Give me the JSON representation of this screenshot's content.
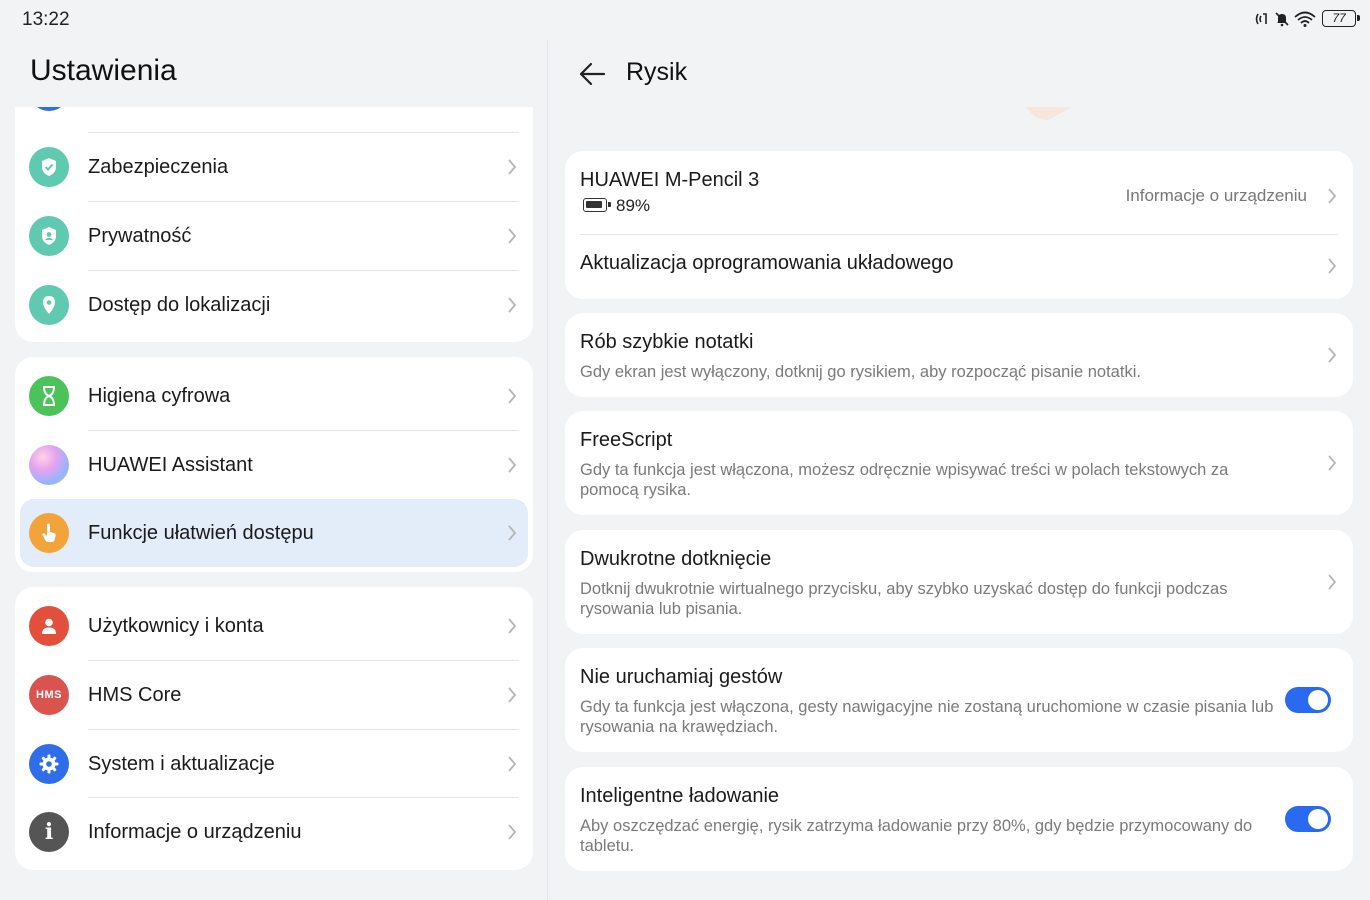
{
  "status": {
    "time": "13:22",
    "battery": "77"
  },
  "left": {
    "title": "Ustawienia",
    "groups": [
      {
        "items": [
          {
            "label": "Zabezpieczenia",
            "icon": "shield-check-icon",
            "color": "#5fcab0"
          },
          {
            "label": "Prywatność",
            "icon": "privacy-shield-icon",
            "color": "#5fcab0"
          },
          {
            "label": "Dostęp do lokalizacji",
            "icon": "location-pin-icon",
            "color": "#5fcab0"
          }
        ]
      },
      {
        "items": [
          {
            "label": "Higiena cyfrowa",
            "icon": "hourglass-icon",
            "color": "#4cc35a"
          },
          {
            "label": "HUAWEI Assistant",
            "icon": "assistant-orb-icon",
            "color": "#c9a1e0"
          },
          {
            "label": "Funkcje ułatwień dostępu",
            "icon": "hand-pointer-icon",
            "color": "#f2a33a",
            "selected": true
          }
        ]
      },
      {
        "items": [
          {
            "label": "Użytkownicy i konta",
            "icon": "user-icon",
            "color": "#e2503c"
          },
          {
            "label": "HMS Core",
            "icon": "hms-icon",
            "icon_text": "HMS",
            "color": "#d9534f"
          },
          {
            "label": "System i aktualizacje",
            "icon": "gear-icon",
            "color": "#2f6ee8"
          },
          {
            "label": "Informacje o urządzeniu",
            "icon": "info-icon",
            "color": "#555555"
          }
        ]
      }
    ]
  },
  "right": {
    "title": "Rysik",
    "device": {
      "name": "HUAWEI M-Pencil 3",
      "battery": "89%",
      "info_link": "Informacje o urządzeniu",
      "firmware": "Aktualizacja oprogramowania układowego"
    },
    "cards": [
      {
        "title": "Rób szybkie notatki",
        "desc": "Gdy ekran jest wyłączony, dotknij go rysikiem, aby rozpocząć pisanie notatki.",
        "control": "chevron"
      },
      {
        "title": "FreeScript",
        "desc": "Gdy ta funkcja jest włączona, możesz odręcznie wpisywać treści w polach tekstowych za pomocą rysika.",
        "control": "chevron"
      },
      {
        "title": "Dwukrotne dotknięcie",
        "desc": "Dotknij dwukrotnie wirtualnego przycisku, aby szybko uzyskać dostęp do funkcji podczas rysowania lub pisania.",
        "control": "chevron"
      },
      {
        "title": "Nie uruchamiaj gestów",
        "desc": "Gdy ta funkcja jest włączona, gesty nawigacyjne nie zostaną uruchomione w czasie pisania lub rysowania na krawędziach.",
        "control": "toggle",
        "on": true
      },
      {
        "title": "Inteligentne ładowanie",
        "desc": "Aby oszczędzać energię, rysik zatrzyma ładowanie przy 80%, gdy będzie przymocowany do tabletu.",
        "control": "toggle",
        "on": true
      }
    ]
  },
  "colors": {
    "accent": "#2a6af0",
    "selected_bg": "#e3ecf9",
    "page_bg": "#f1f3f5"
  }
}
